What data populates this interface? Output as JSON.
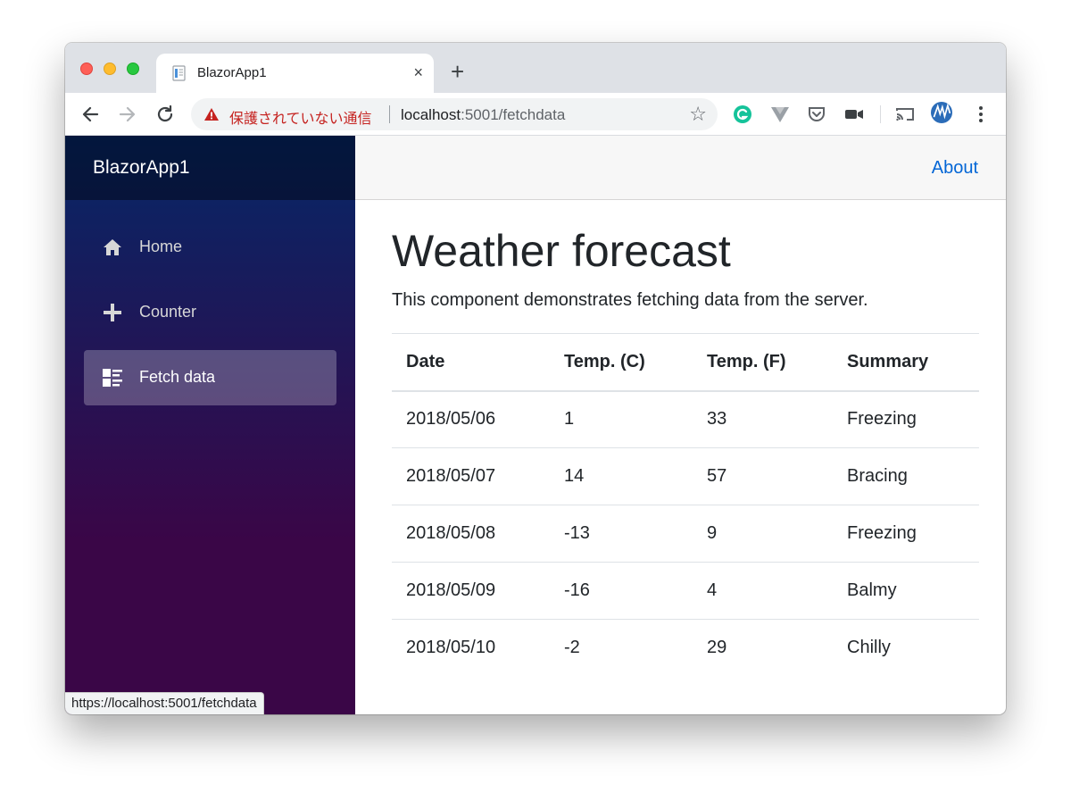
{
  "browser": {
    "tab_title": "BlazorApp1",
    "tab_close": "×",
    "new_tab": "+",
    "security_warning": "保護されていない通信",
    "url_host": "localhost",
    "url_rest": ":5001/fetchdata",
    "star": "☆",
    "status_url": "https://localhost:5001/fetchdata",
    "icons": [
      "back-icon",
      "forward-icon",
      "reload-icon",
      "warning-icon",
      "star-icon",
      "grammarly-icon",
      "vue-devtools-icon",
      "pocket-icon",
      "video-icon",
      "cast-icon",
      "profile-avatar",
      "more-menu-icon"
    ]
  },
  "app": {
    "brand": "BlazorApp1",
    "about": "About",
    "nav": [
      {
        "label": "Home",
        "icon": "home-icon"
      },
      {
        "label": "Counter",
        "icon": "plus-icon"
      },
      {
        "label": "Fetch data",
        "icon": "list-rich-icon"
      }
    ],
    "active_nav": "Fetch data",
    "accent_color": "#0366d6"
  },
  "main": {
    "title": "Weather forecast",
    "lead": "This component demonstrates fetching data from the server.",
    "table": {
      "headers": [
        "Date",
        "Temp. (C)",
        "Temp. (F)",
        "Summary"
      ],
      "rows": [
        [
          "2018/05/06",
          "1",
          "33",
          "Freezing"
        ],
        [
          "2018/05/07",
          "14",
          "57",
          "Bracing"
        ],
        [
          "2018/05/08",
          "-13",
          "9",
          "Freezing"
        ],
        [
          "2018/05/09",
          "-16",
          "4",
          "Balmy"
        ],
        [
          "2018/05/10",
          "-2",
          "29",
          "Chilly"
        ]
      ]
    }
  }
}
